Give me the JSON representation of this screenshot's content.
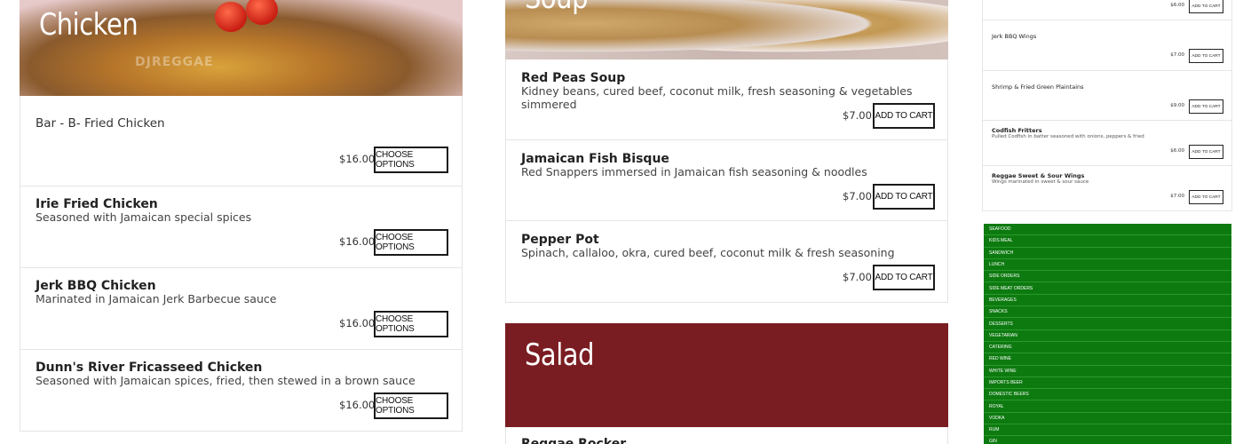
{
  "sections": {
    "chicken_title": "Chicken",
    "soup_title": "Soup",
    "salad_title": "Salad",
    "watermark": "DJREGGAE"
  },
  "chicken_items": [
    {
      "name": "Bar - B- Fried Chicken",
      "desc": "",
      "price": "$16.00",
      "button": "Choose Options"
    },
    {
      "name": "Irie Fried Chicken",
      "desc": "Seasoned with Jamaican special spices",
      "price": "$16.00",
      "button": "Choose Options"
    },
    {
      "name": "Jerk BBQ Chicken",
      "desc": "Marinated in Jamaican Jerk Barbecue sauce",
      "price": "$16.00",
      "button": "Choose Options"
    },
    {
      "name": "Dunn's River Fricasseed Chicken",
      "desc": "Seasoned with Jamaican spices, fried, then stewed in a brown sauce",
      "price": "$16.00",
      "button": "Choose Options"
    }
  ],
  "soup_items": [
    {
      "name": "Red Peas Soup",
      "desc": "Kidney beans, cured beef, coconut milk, fresh seasoning & vegetables simmered",
      "price": "$7.00",
      "button": "Add to Cart"
    },
    {
      "name": "Jamaican Fish Bisque",
      "desc": "Red Snappers immersed in Jamaican fish seasoning & noodles",
      "price": "$7.00",
      "button": "Add to Cart"
    },
    {
      "name": "Pepper Pot",
      "desc": "Spinach, callaloo, okra, cured beef, coconut milk & fresh seasoning",
      "price": "$7.00",
      "button": "Add to Cart"
    }
  ],
  "salad_items": [
    {
      "name": "Reggae Rocker"
    }
  ],
  "appetizer_items": [
    {
      "name": "",
      "desc": "",
      "price": "$6.00",
      "button": "Add to Cart"
    },
    {
      "name": "Jerk BBQ Wings",
      "desc": "",
      "price": "$7.00",
      "button": "Add to Cart"
    },
    {
      "name": "Shrimp & Fried Green Plaintains",
      "desc": "",
      "price": "$9.00",
      "button": "Add to Cart"
    },
    {
      "name": "Codfish Fritters",
      "desc": "Pulled Codfish in batter seasoned with onions, peppers & fried",
      "price": "$6.00",
      "button": "Add to Cart"
    },
    {
      "name": "Reggae Sweet & Sour Wings",
      "desc": "Wings marinated in sweet & sour sauce",
      "price": "$7.00",
      "button": "Add to Cart"
    }
  ],
  "categories": [
    "Seafood",
    "Kids Meal",
    "Sandwich",
    "Lunch",
    "Side Orders",
    "Side Meat Orders",
    "Beverages",
    "Snacks",
    "Desserts",
    "Vegetarian",
    "Catering",
    "Red Wine",
    "White Wine",
    "Imports Beer",
    "Domestic Beers",
    "Royal",
    "Vodka",
    "Rum",
    "Gin"
  ],
  "colors": {
    "salad_banner": "#7a1d22",
    "category_menu": "#0d7a10"
  }
}
